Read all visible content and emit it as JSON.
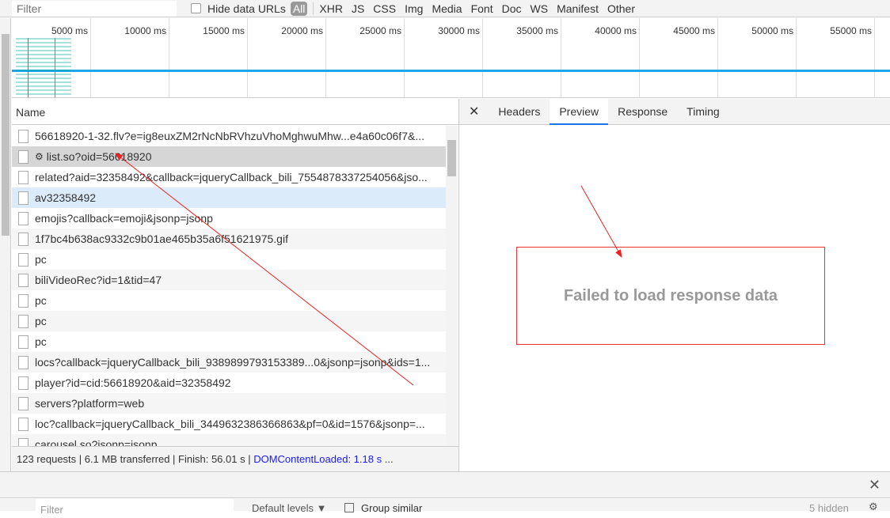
{
  "toolbar": {
    "filter_placeholder": "Filter",
    "hide_data_urls": "Hide data URLs",
    "types": [
      "All",
      "XHR",
      "JS",
      "CSS",
      "Img",
      "Media",
      "Font",
      "Doc",
      "WS",
      "Manifest",
      "Other"
    ]
  },
  "overview": {
    "ticks": [
      "5000 ms",
      "10000 ms",
      "15000 ms",
      "20000 ms",
      "25000 ms",
      "30000 ms",
      "35000 ms",
      "40000 ms",
      "45000 ms",
      "50000 ms",
      "55000 ms"
    ]
  },
  "list": {
    "header": "Name",
    "rows": [
      "56618920-1-32.flv?e=ig8euxZM2rNcNbRVhzuVhoMghwuMhw...e4a60c06f7&...",
      "list.so?oid=56618920",
      "related?aid=32358492&callback=jqueryCallback_bili_7554878337254056&jso...",
      "av32358492",
      "emojis?callback=emoji&jsonp=jsonp",
      "1f7bc4b638ac9332c9b01ae465b35a6f51621975.gif",
      "pc",
      "biliVideoRec?id=1&tid=47",
      "pc",
      "pc",
      "pc",
      "locs?callback=jqueryCallback_bili_9389899793153389...0&jsonp=jsonp&ids=1...",
      "player?id=cid:56618920&aid=32358492",
      "servers?platform=web",
      "loc?callback=jqueryCallback_bili_3449632386366863&pf=0&id=1576&jsonp=...",
      "carousel.so?jsonp=jsonp"
    ]
  },
  "status": {
    "requests": "123 requests",
    "transferred": "6.1 MB transferred",
    "finish": "Finish: 56.01 s",
    "dcl": "DOMContentLoaded: 1.18 s",
    "more": "..."
  },
  "detail": {
    "tabs": [
      "Headers",
      "Preview",
      "Response",
      "Timing"
    ],
    "active": "Preview",
    "message": "Failed to load response data"
  },
  "console": {
    "filter_placeholder": "Filter",
    "levels": "Default levels ▼",
    "group_similar": "Group similar",
    "hidden": "5 hidden"
  },
  "colors": {
    "accent": "#1a73e8",
    "annotation": "#ee2222",
    "dcl": "#1a1aff"
  }
}
